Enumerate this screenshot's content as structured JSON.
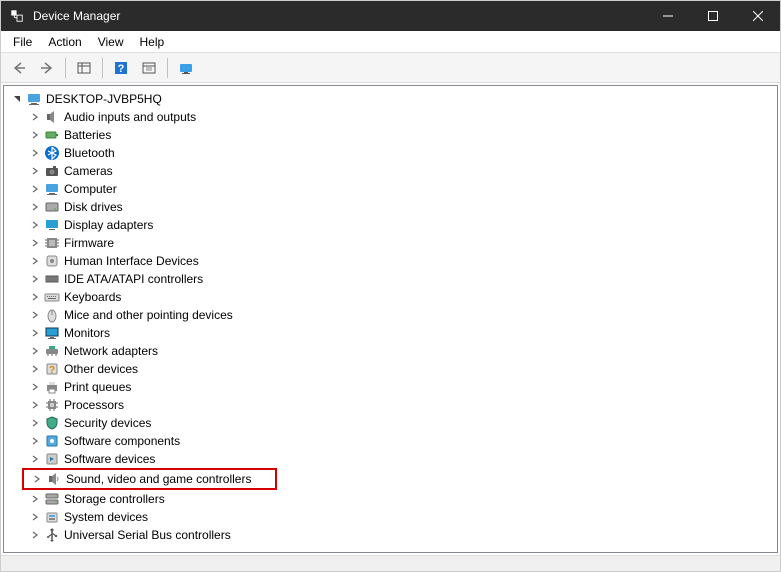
{
  "window": {
    "title": "Device Manager"
  },
  "menubar": {
    "file": "File",
    "action": "Action",
    "view": "View",
    "help": "Help"
  },
  "tree": {
    "root": "DESKTOP-JVBP5HQ",
    "categories": [
      {
        "label": "Audio inputs and outputs",
        "icon": "speaker"
      },
      {
        "label": "Batteries",
        "icon": "battery"
      },
      {
        "label": "Bluetooth",
        "icon": "bluetooth"
      },
      {
        "label": "Cameras",
        "icon": "camera"
      },
      {
        "label": "Computer",
        "icon": "computer"
      },
      {
        "label": "Disk drives",
        "icon": "disk"
      },
      {
        "label": "Display adapters",
        "icon": "display"
      },
      {
        "label": "Firmware",
        "icon": "firmware"
      },
      {
        "label": "Human Interface Devices",
        "icon": "hid"
      },
      {
        "label": "IDE ATA/ATAPI controllers",
        "icon": "ide"
      },
      {
        "label": "Keyboards",
        "icon": "keyboard"
      },
      {
        "label": "Mice and other pointing devices",
        "icon": "mouse"
      },
      {
        "label": "Monitors",
        "icon": "monitor"
      },
      {
        "label": "Network adapters",
        "icon": "network"
      },
      {
        "label": "Other devices",
        "icon": "other"
      },
      {
        "label": "Print queues",
        "icon": "printer"
      },
      {
        "label": "Processors",
        "icon": "cpu"
      },
      {
        "label": "Security devices",
        "icon": "security"
      },
      {
        "label": "Software components",
        "icon": "softcomp"
      },
      {
        "label": "Software devices",
        "icon": "softdev"
      },
      {
        "label": "Sound, video and game controllers",
        "icon": "sound",
        "highlighted": true
      },
      {
        "label": "Storage controllers",
        "icon": "storage"
      },
      {
        "label": "System devices",
        "icon": "system"
      },
      {
        "label": "Universal Serial Bus controllers",
        "icon": "usb"
      }
    ]
  }
}
